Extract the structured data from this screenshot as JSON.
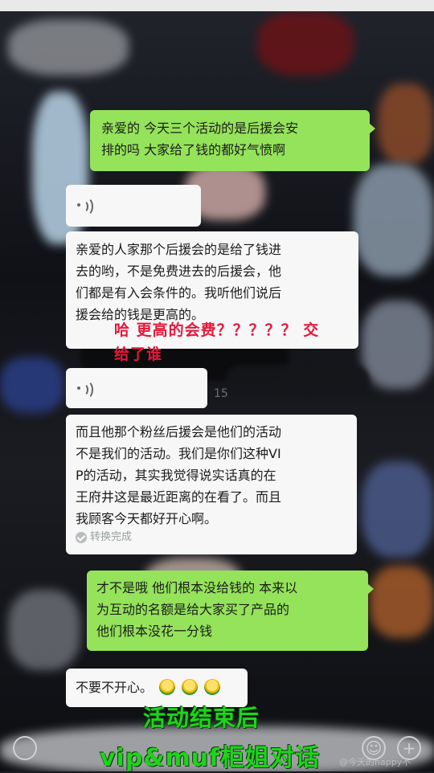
{
  "messages": [
    {
      "side": "right",
      "text": "亲爱的 今天三个活动的是后援会安\n排的吗 大家给了钱的都好气愤啊"
    },
    {
      "side": "left",
      "voice": true
    },
    {
      "side": "left",
      "text": "亲爱的人家那个后援会的是给了钱进\n去的哟，不是免费进去的后援会，他\n们都是有入会条件的。我听他们说后\n援会给的钱是更高的。"
    },
    {
      "side": "left",
      "voice": true
    },
    {
      "side": "left",
      "text": "而且他那个粉丝后援会是他们的活动\n不是我们的活动。我们是你们这种VI\nP的活动，其实我觉得说实话真的在\n王府井这是最近距离的在看了。而且\n我顾客今天都好开心啊。",
      "status": "转换完成"
    },
    {
      "side": "right",
      "text": "才不是哦 他们根本没给钱的 本来以\n为互动的名额是给大家买了产品的\n他们根本没花一分钱"
    },
    {
      "side": "left",
      "text": "不要不开心。"
    }
  ],
  "annotation": "哈  更高的会费？？？？？ 交\n给了谁",
  "timestamp": "15",
  "caption": {
    "line1": "活动结束后",
    "line2": "vip&muf柜姐对话"
  },
  "watermark": "@今天的happy不"
}
